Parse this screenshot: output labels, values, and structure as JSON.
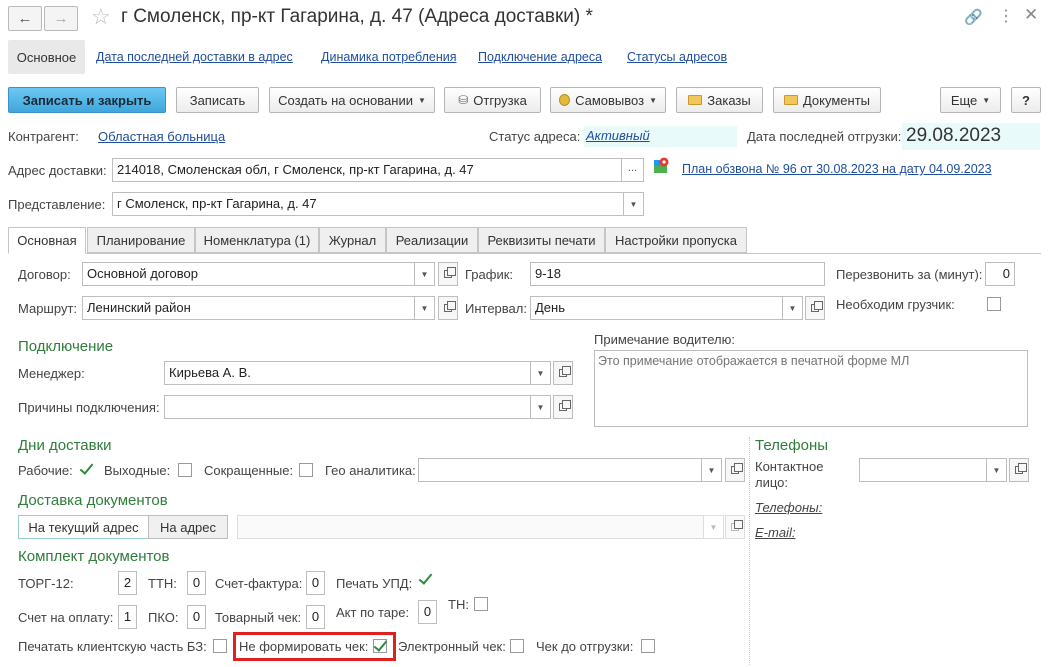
{
  "window": {
    "title": "г Смоленск,  пр-кт Гагарина,  д. 47 (Адреса доставки) *"
  },
  "nav_tabs": [
    "Основное",
    "Дата последней доставки в адрес",
    "Динамика потребления",
    "Подключение адреса",
    "Статусы адресов"
  ],
  "toolbar": {
    "save_close": "Записать и закрыть",
    "save": "Записать",
    "create_based": "Создать на основании",
    "shipment": "Отгрузка",
    "pickup": "Самовывоз",
    "orders": "Заказы",
    "documents": "Документы",
    "more": "Еще",
    "help": "?"
  },
  "header": {
    "counterparty_label": "Контрагент:",
    "counterparty_value": "Областная больница",
    "status_label": "Статус адреса:",
    "status_value": "Активный",
    "last_ship_label": "Дата последней отгрузки:",
    "last_ship_value": "29.08.2023",
    "address_label": "Адрес доставки:",
    "address_value": "214018, Смоленская обл, г Смоленск, пр-кт Гагарина, д. 47",
    "address_more": "...",
    "call_plan_link": "План обзвона № 96 от 30.08.2023 на дату 04.09.2023",
    "representation_label": "Представление:",
    "representation_value": "г Смоленск,  пр-кт Гагарина,  д. 47"
  },
  "tabs": [
    "Основная",
    "Планирование",
    "Номенклатура (1)",
    "Журнал",
    "Реализации",
    "Реквизиты печати",
    "Настройки пропуска"
  ],
  "main": {
    "contract_label": "Договор:",
    "contract_value": "Основной договор",
    "route_label": "Маршрут:",
    "route_value": "Ленинский район",
    "schedule_label": "График:",
    "schedule_value": "9-18",
    "interval_label": "Интервал:",
    "interval_value": "День",
    "callback_label": "Перезвонить за (минут):",
    "callback_value": "0",
    "loader_label": "Необходим грузчик:",
    "driver_note_label": "Примечание водителю:",
    "driver_note_placeholder": "Это примечание отображается в печатной форме МЛ",
    "connection_title": "Подключение",
    "manager_label": "Менеджер:",
    "manager_value": "Кирьева А. В.",
    "reasons_label": "Причины подключения:",
    "delivery_days_title": "Дни доставки",
    "workdays_label": "Рабочие:",
    "weekends_label": "Выходные:",
    "short_label": "Сокращенные:",
    "geo_label": "Гео аналитика:",
    "doc_delivery_title": "Доставка документов",
    "to_current_address": "На текущий адрес",
    "to_address": "На адрес",
    "phones_title": "Телефоны",
    "contact_label": "Контактное лицо:",
    "phones_label": "Телефоны:",
    "email_label": "E-mail:",
    "doc_set_title": "Комплект документов",
    "torg12_label": "ТОРГ-12:",
    "torg12_value": "2",
    "ttn_label": "ТТН:",
    "ttn_value": "0",
    "invoice_label": "Счет-фактура:",
    "invoice_value": "0",
    "upd_label": "Печать УПД:",
    "payment_invoice_label": "Счет на оплату:",
    "payment_invoice_value": "1",
    "pko_label": "ПКО:",
    "pko_value": "0",
    "sales_receipt_label": "Товарный чек:",
    "sales_receipt_value": "0",
    "tare_act_label": "Акт по таре:",
    "tare_act_value": "0",
    "tn_label": "ТН:",
    "print_client_part_label": "Печатать клиентскую часть БЗ:",
    "no_receipt_label": "Не формировать чек:",
    "e_receipt_label": "Электронный чек:",
    "receipt_before_ship_label": "Чек до отгрузки:"
  },
  "colors": {
    "accent_green": "#2f7d3b",
    "link": "#1f4e9c",
    "highlight": "#e0201f",
    "primary_button": "#4db3e6"
  }
}
